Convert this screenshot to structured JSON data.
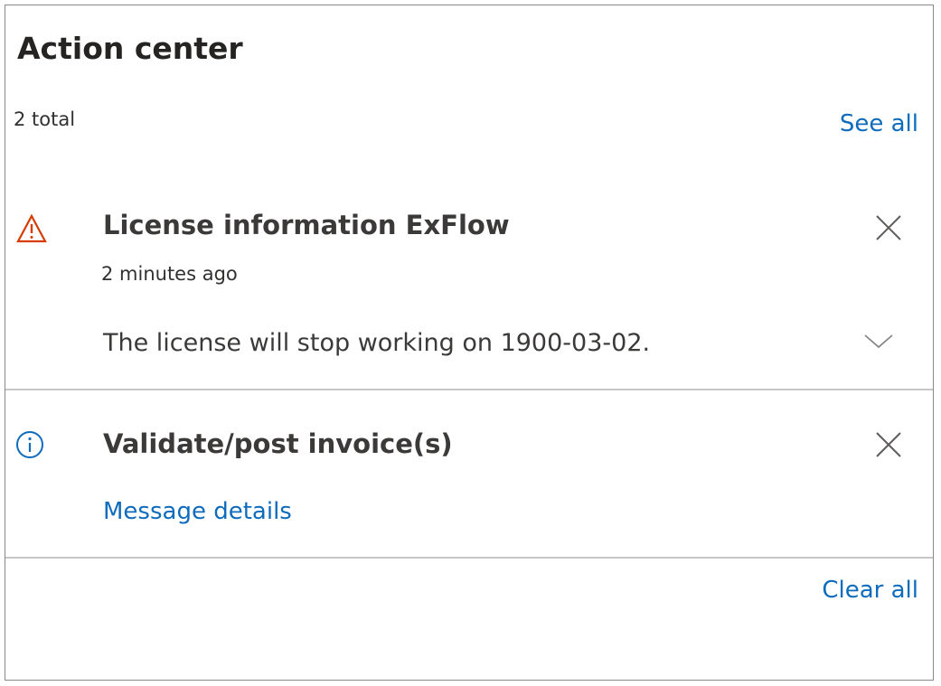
{
  "action_center": {
    "title": "Action center",
    "total_label": "2 total",
    "see_all_label": "See all",
    "clear_all_label": "Clear all",
    "notifications": [
      {
        "icon": "warning-icon",
        "title": "License information ExFlow",
        "time": "2 minutes ago",
        "body": "The license will stop working on 1900-03-02."
      },
      {
        "icon": "info-icon",
        "title": "Validate/post invoice(s)",
        "link_label": "Message details"
      }
    ]
  },
  "colors": {
    "link": "#0f6cbd",
    "warning": "#d83b01",
    "info": "#0f6cbd",
    "divider": "#c8c6c4",
    "border": "#8a8886"
  }
}
